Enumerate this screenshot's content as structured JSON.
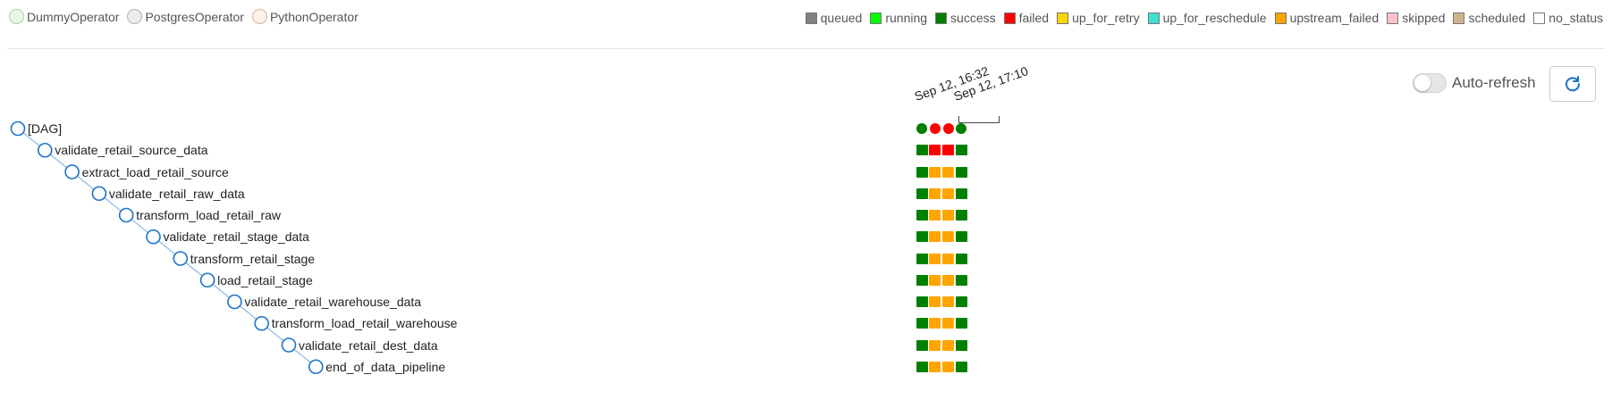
{
  "operator_legend": [
    {
      "label": "DummyOperator",
      "color": "#e8f7e4",
      "border": "#9fd69a"
    },
    {
      "label": "PostgresOperator",
      "color": "#ededed",
      "border": "#b0b0b0"
    },
    {
      "label": "PythonOperator",
      "color": "#fff0e8",
      "border": "#d7b7a8"
    }
  ],
  "state_legend": [
    {
      "label": "queued",
      "color": "#808080"
    },
    {
      "label": "running",
      "color": "#00ff00"
    },
    {
      "label": "success",
      "color": "#008000"
    },
    {
      "label": "failed",
      "color": "#ff0000"
    },
    {
      "label": "up_for_retry",
      "color": "#ffd700"
    },
    {
      "label": "up_for_reschedule",
      "color": "#40e0d0"
    },
    {
      "label": "upstream_failed",
      "color": "#ffa500"
    },
    {
      "label": "skipped",
      "color": "#ffc0cb"
    },
    {
      "label": "scheduled",
      "color": "#d2b48c"
    },
    {
      "label": "no_status",
      "color": "#ffffff"
    }
  ],
  "auto_refresh": {
    "label": "Auto-refresh",
    "enabled": false
  },
  "refresh_icon": "refresh-icon",
  "dates": [
    "Sep 12, 16:32",
    "Sep 12, 17:10"
  ],
  "tasks": [
    {
      "name": "[DAG]",
      "states": [
        "success",
        "failed",
        "failed",
        "success"
      ]
    },
    {
      "name": "validate_retail_source_data",
      "states": [
        "success",
        "failed",
        "failed",
        "success"
      ]
    },
    {
      "name": "extract_load_retail_source",
      "states": [
        "success",
        "upstream_failed",
        "upstream_failed",
        "success"
      ]
    },
    {
      "name": "validate_retail_raw_data",
      "states": [
        "success",
        "upstream_failed",
        "upstream_failed",
        "success"
      ]
    },
    {
      "name": "transform_load_retail_raw",
      "states": [
        "success",
        "upstream_failed",
        "upstream_failed",
        "success"
      ]
    },
    {
      "name": "validate_retail_stage_data",
      "states": [
        "success",
        "upstream_failed",
        "upstream_failed",
        "success"
      ]
    },
    {
      "name": "transform_retail_stage",
      "states": [
        "success",
        "upstream_failed",
        "upstream_failed",
        "success"
      ]
    },
    {
      "name": "load_retail_stage",
      "states": [
        "success",
        "upstream_failed",
        "upstream_failed",
        "success"
      ]
    },
    {
      "name": "validate_retail_warehouse_data",
      "states": [
        "success",
        "upstream_failed",
        "upstream_failed",
        "success"
      ]
    },
    {
      "name": "transform_load_retail_warehouse",
      "states": [
        "success",
        "upstream_failed",
        "upstream_failed",
        "success"
      ]
    },
    {
      "name": "validate_retail_dest_data",
      "states": [
        "success",
        "upstream_failed",
        "upstream_failed",
        "success"
      ]
    },
    {
      "name": "end_of_data_pipeline",
      "states": [
        "success",
        "upstream_failed",
        "upstream_failed",
        "success"
      ]
    }
  ]
}
